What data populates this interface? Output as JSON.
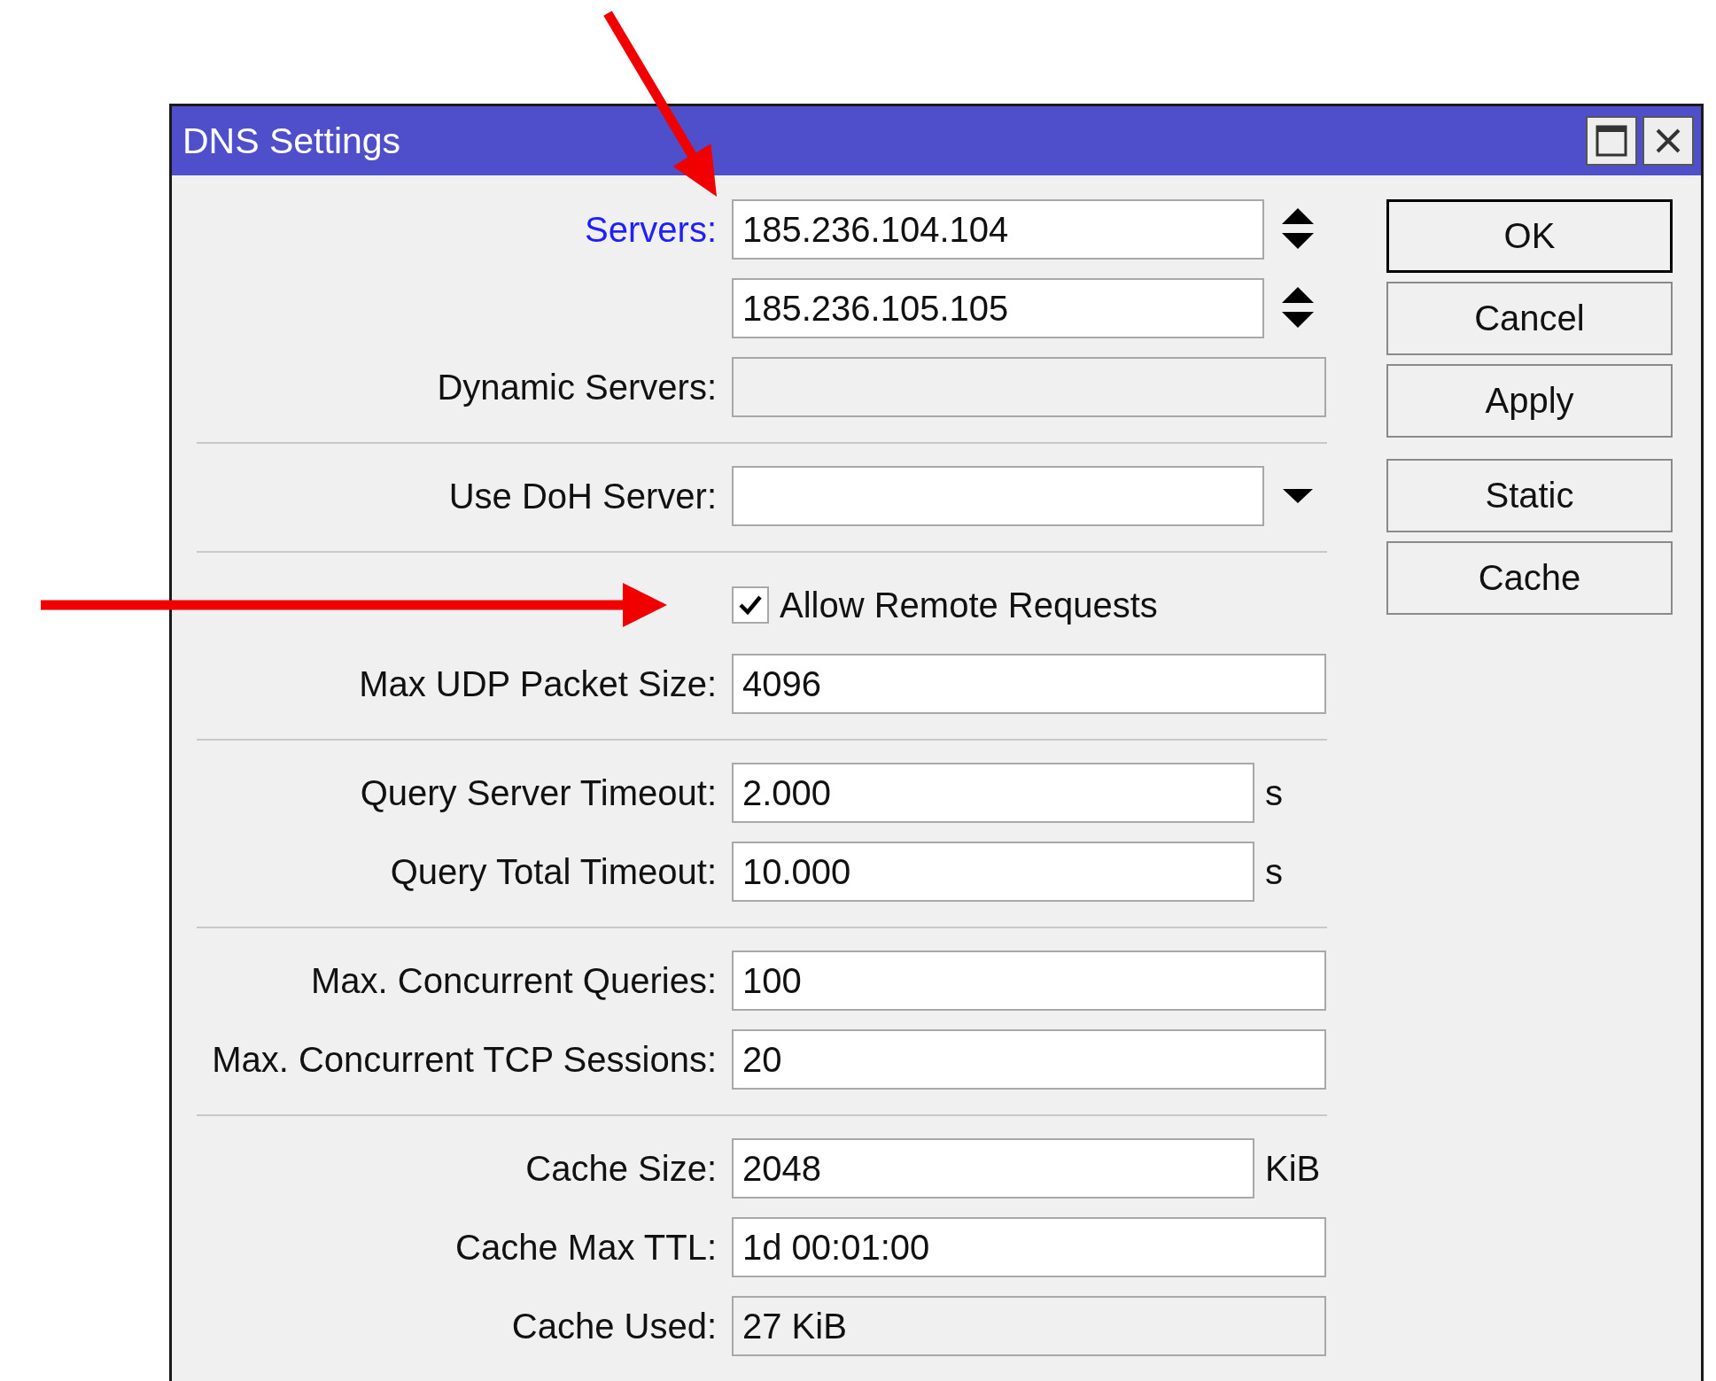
{
  "window": {
    "title": "DNS Settings"
  },
  "form": {
    "sections": [
      {
        "rows": [
          {
            "kind": "multi",
            "label": "Servers:",
            "link": true,
            "values": [
              "185.236.104.104",
              "185.236.105.105"
            ]
          },
          {
            "kind": "field",
            "label": "Dynamic Servers:",
            "link": false,
            "readonly": true
          }
        ]
      },
      {
        "rows": [
          {
            "kind": "dropdown",
            "label": "Use DoH Server:",
            "link": false,
            "readonly": false
          }
        ]
      },
      {
        "rows": [
          {
            "kind": "checkbox",
            "label": "Allow Remote Requests",
            "checked": true
          },
          {
            "kind": "field",
            "label": "Max UDP Packet Size:",
            "link": false,
            "value": "4096",
            "readonly": false
          }
        ]
      },
      {
        "rows": [
          {
            "kind": "field",
            "label": "Query Server Timeout:",
            "link": false,
            "value": "2.000",
            "readonly": false,
            "unit": "s"
          },
          {
            "kind": "field",
            "label": "Query Total Timeout:",
            "link": false,
            "value": "10.000",
            "readonly": false,
            "unit": "s"
          }
        ]
      },
      {
        "rows": [
          {
            "kind": "field",
            "label": "Max. Concurrent Queries:",
            "link": false,
            "value": "100",
            "readonly": false
          },
          {
            "kind": "field",
            "label": "Max. Concurrent TCP Sessions:",
            "link": false,
            "value": "20",
            "readonly": false
          }
        ]
      },
      {
        "rows": [
          {
            "kind": "field",
            "label": "Cache Size:",
            "link": false,
            "value": "2048",
            "readonly": false,
            "unit": "KiB"
          },
          {
            "kind": "field",
            "label": "Cache Max TTL:",
            "link": false,
            "value": "1d 00:01:00",
            "readonly": false
          },
          {
            "kind": "field",
            "label": "Cache Used:",
            "link": false,
            "value": "27 KiB",
            "readonly": true
          }
        ]
      }
    ]
  },
  "button_groups": [
    {
      "buttons": [
        {
          "label": "OK",
          "default": true
        },
        {
          "label": "Cancel",
          "default": false
        },
        {
          "label": "Apply",
          "default": false
        }
      ]
    },
    {
      "buttons": [
        {
          "label": "Static",
          "default": false
        },
        {
          "label": "Cache",
          "default": false
        }
      ]
    }
  ]
}
